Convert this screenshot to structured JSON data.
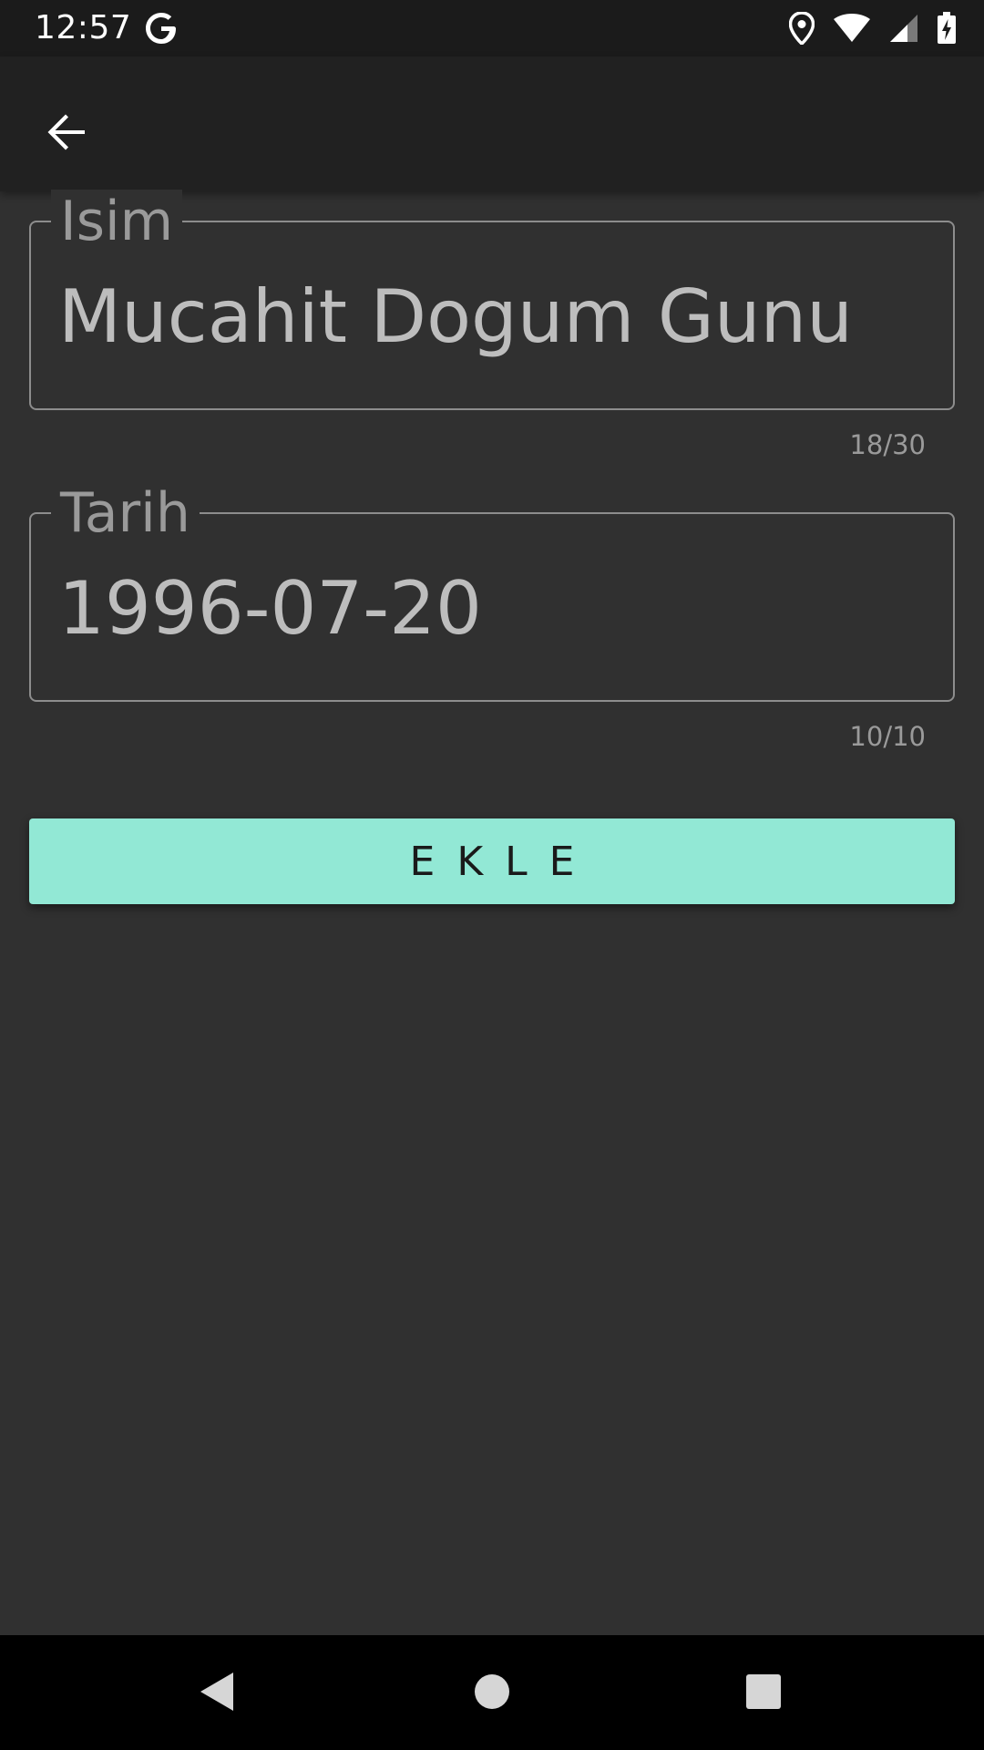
{
  "status_bar": {
    "time": "12:57",
    "icons": [
      "google-icon",
      "location-icon",
      "wifi-icon",
      "signal-icon",
      "battery-charging-icon"
    ]
  },
  "app_bar": {
    "back_icon": "arrow-back-icon"
  },
  "form": {
    "name_field": {
      "label": "Isim",
      "value": "Mucahit Dogum Gunu",
      "counter": "18/30"
    },
    "date_field": {
      "label": "Tarih",
      "value": "1996-07-20",
      "counter": "10/10"
    },
    "add_button_label": "EKLE"
  },
  "colors": {
    "background": "#303030",
    "app_bar": "#212121",
    "accent": "#92e8d5",
    "field_border": "#8d8d8d"
  },
  "nav_bar": {
    "icons": [
      "nav-back-icon",
      "nav-home-icon",
      "nav-recents-icon"
    ]
  }
}
